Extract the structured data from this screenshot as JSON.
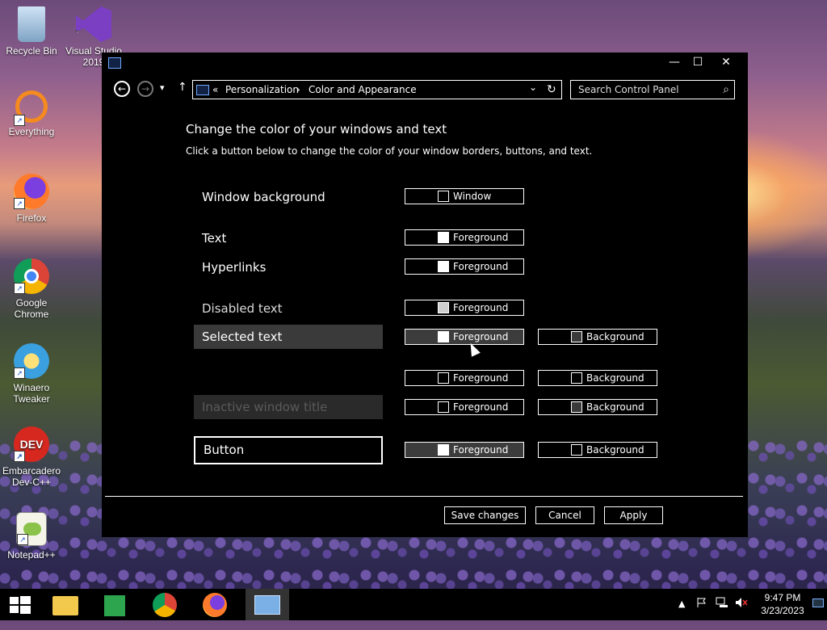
{
  "desktop": {
    "icons": [
      {
        "label": "Recycle Bin"
      },
      {
        "label": "Visual Studio 2019"
      },
      {
        "label": "Everything"
      },
      {
        "label": "Firefox"
      },
      {
        "label": "Google Chrome"
      },
      {
        "label": "Winaero Tweaker"
      },
      {
        "label": "Embarcadero Dev-C++"
      },
      {
        "label": "Notepad++"
      }
    ]
  },
  "window": {
    "controls": {
      "minimize": "—",
      "maximize": "☐",
      "close": "✕"
    },
    "nav": {
      "back": "←",
      "forward": "→",
      "dropdown": "▾",
      "up": "↑",
      "address": {
        "prefix": "«",
        "crumb1": "Personalization",
        "sep": "›",
        "crumb2": "Color and Appearance",
        "chevron": "⌄",
        "refresh": "↻"
      },
      "search_placeholder": "Search Control Panel",
      "search_icon": "⌕"
    },
    "heading": "Change the color of your windows and text",
    "subheading": "Click a button below to change the color of your window borders, buttons, and text.",
    "rows": {
      "window_background": {
        "label": "Window background",
        "fg": "Window"
      },
      "text": {
        "label": "Text",
        "fg": "Foreground"
      },
      "hyperlinks": {
        "label": "Hyperlinks",
        "fg": "Foreground"
      },
      "disabled_text": {
        "label": "Disabled text",
        "fg": "Foreground"
      },
      "selected_text": {
        "label": "Selected text",
        "fg": "Foreground",
        "bg": "Background"
      },
      "active_title": {
        "fg": "Foreground",
        "bg": "Background"
      },
      "inactive_title": {
        "label": "Inactive window title",
        "fg": "Foreground",
        "bg": "Background"
      },
      "button": {
        "label": "Button",
        "fg": "Foreground",
        "bg": "Background"
      }
    },
    "footer": {
      "save": "Save changes",
      "cancel": "Cancel",
      "apply": "Apply"
    }
  },
  "taskbar": {
    "clock_time": "9:47 PM",
    "clock_date": "3/23/2023",
    "tray": {
      "chevron": "▲"
    }
  }
}
